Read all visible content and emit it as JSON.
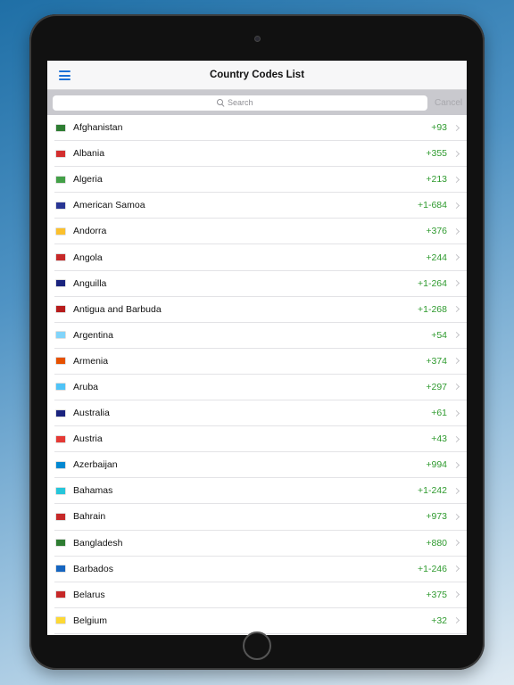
{
  "navbar": {
    "title": "Country Codes List",
    "menu_icon": "hamburger-menu-icon",
    "accent_color": "#1a6fd6"
  },
  "search": {
    "placeholder": "Search",
    "cancel_label": "Cancel"
  },
  "countries": [
    {
      "name": "Afghanistan",
      "code": "+93",
      "flag_color": "#2e7d32"
    },
    {
      "name": "Albania",
      "code": "+355",
      "flag_color": "#d32f2f"
    },
    {
      "name": "Algeria",
      "code": "+213",
      "flag_color": "#43a047"
    },
    {
      "name": "American Samoa",
      "code": "+1-684",
      "flag_color": "#283593"
    },
    {
      "name": "Andorra",
      "code": "+376",
      "flag_color": "#fbc02d"
    },
    {
      "name": "Angola",
      "code": "+244",
      "flag_color": "#c62828"
    },
    {
      "name": "Anguilla",
      "code": "+1-264",
      "flag_color": "#1a237e"
    },
    {
      "name": "Antigua and Barbuda",
      "code": "+1-268",
      "flag_color": "#b71c1c"
    },
    {
      "name": "Argentina",
      "code": "+54",
      "flag_color": "#81d4fa"
    },
    {
      "name": "Armenia",
      "code": "+374",
      "flag_color": "#e65100"
    },
    {
      "name": "Aruba",
      "code": "+297",
      "flag_color": "#4fc3f7"
    },
    {
      "name": "Australia",
      "code": "+61",
      "flag_color": "#1a237e"
    },
    {
      "name": "Austria",
      "code": "+43",
      "flag_color": "#e53935"
    },
    {
      "name": "Azerbaijan",
      "code": "+994",
      "flag_color": "#0288d1"
    },
    {
      "name": "Bahamas",
      "code": "+1-242",
      "flag_color": "#26c6da"
    },
    {
      "name": "Bahrain",
      "code": "+973",
      "flag_color": "#c62828"
    },
    {
      "name": "Bangladesh",
      "code": "+880",
      "flag_color": "#2e7d32"
    },
    {
      "name": "Barbados",
      "code": "+1-246",
      "flag_color": "#1565c0"
    },
    {
      "name": "Belarus",
      "code": "+375",
      "flag_color": "#c62828"
    },
    {
      "name": "Belgium",
      "code": "+32",
      "flag_color": "#fdd835"
    }
  ],
  "code_color": "#2e9a2e"
}
